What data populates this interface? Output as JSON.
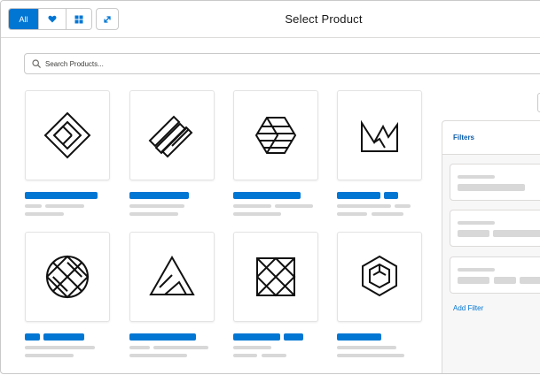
{
  "header": {
    "title": "Select Product",
    "filter_all_label": "All",
    "favorites_icon": "heart-icon",
    "grid_icon": "grid-icon",
    "expand_icon": "expand-icon"
  },
  "search": {
    "placeholder": "Search Products...",
    "icon": "search-icon"
  },
  "products": [
    {
      "icon": "diamond-tile-logo-icon"
    },
    {
      "icon": "diagonal-stripes-logo-icon"
    },
    {
      "icon": "hexagon-stripes-logo-icon"
    },
    {
      "icon": "crown-logo-icon"
    },
    {
      "icon": "circle-lattice-logo-icon"
    },
    {
      "icon": "triangle-peaks-logo-icon"
    },
    {
      "icon": "square-lattice-logo-icon"
    },
    {
      "icon": "nested-hexagon-logo-icon"
    }
  ],
  "filters": {
    "title": "Filters",
    "add_filter_label": "Add Filter"
  },
  "colors": {
    "brand": "#0176d3",
    "link": "#0b5cab",
    "placeholder_bar": "#d8d8d8",
    "border": "#c9c9c9"
  }
}
